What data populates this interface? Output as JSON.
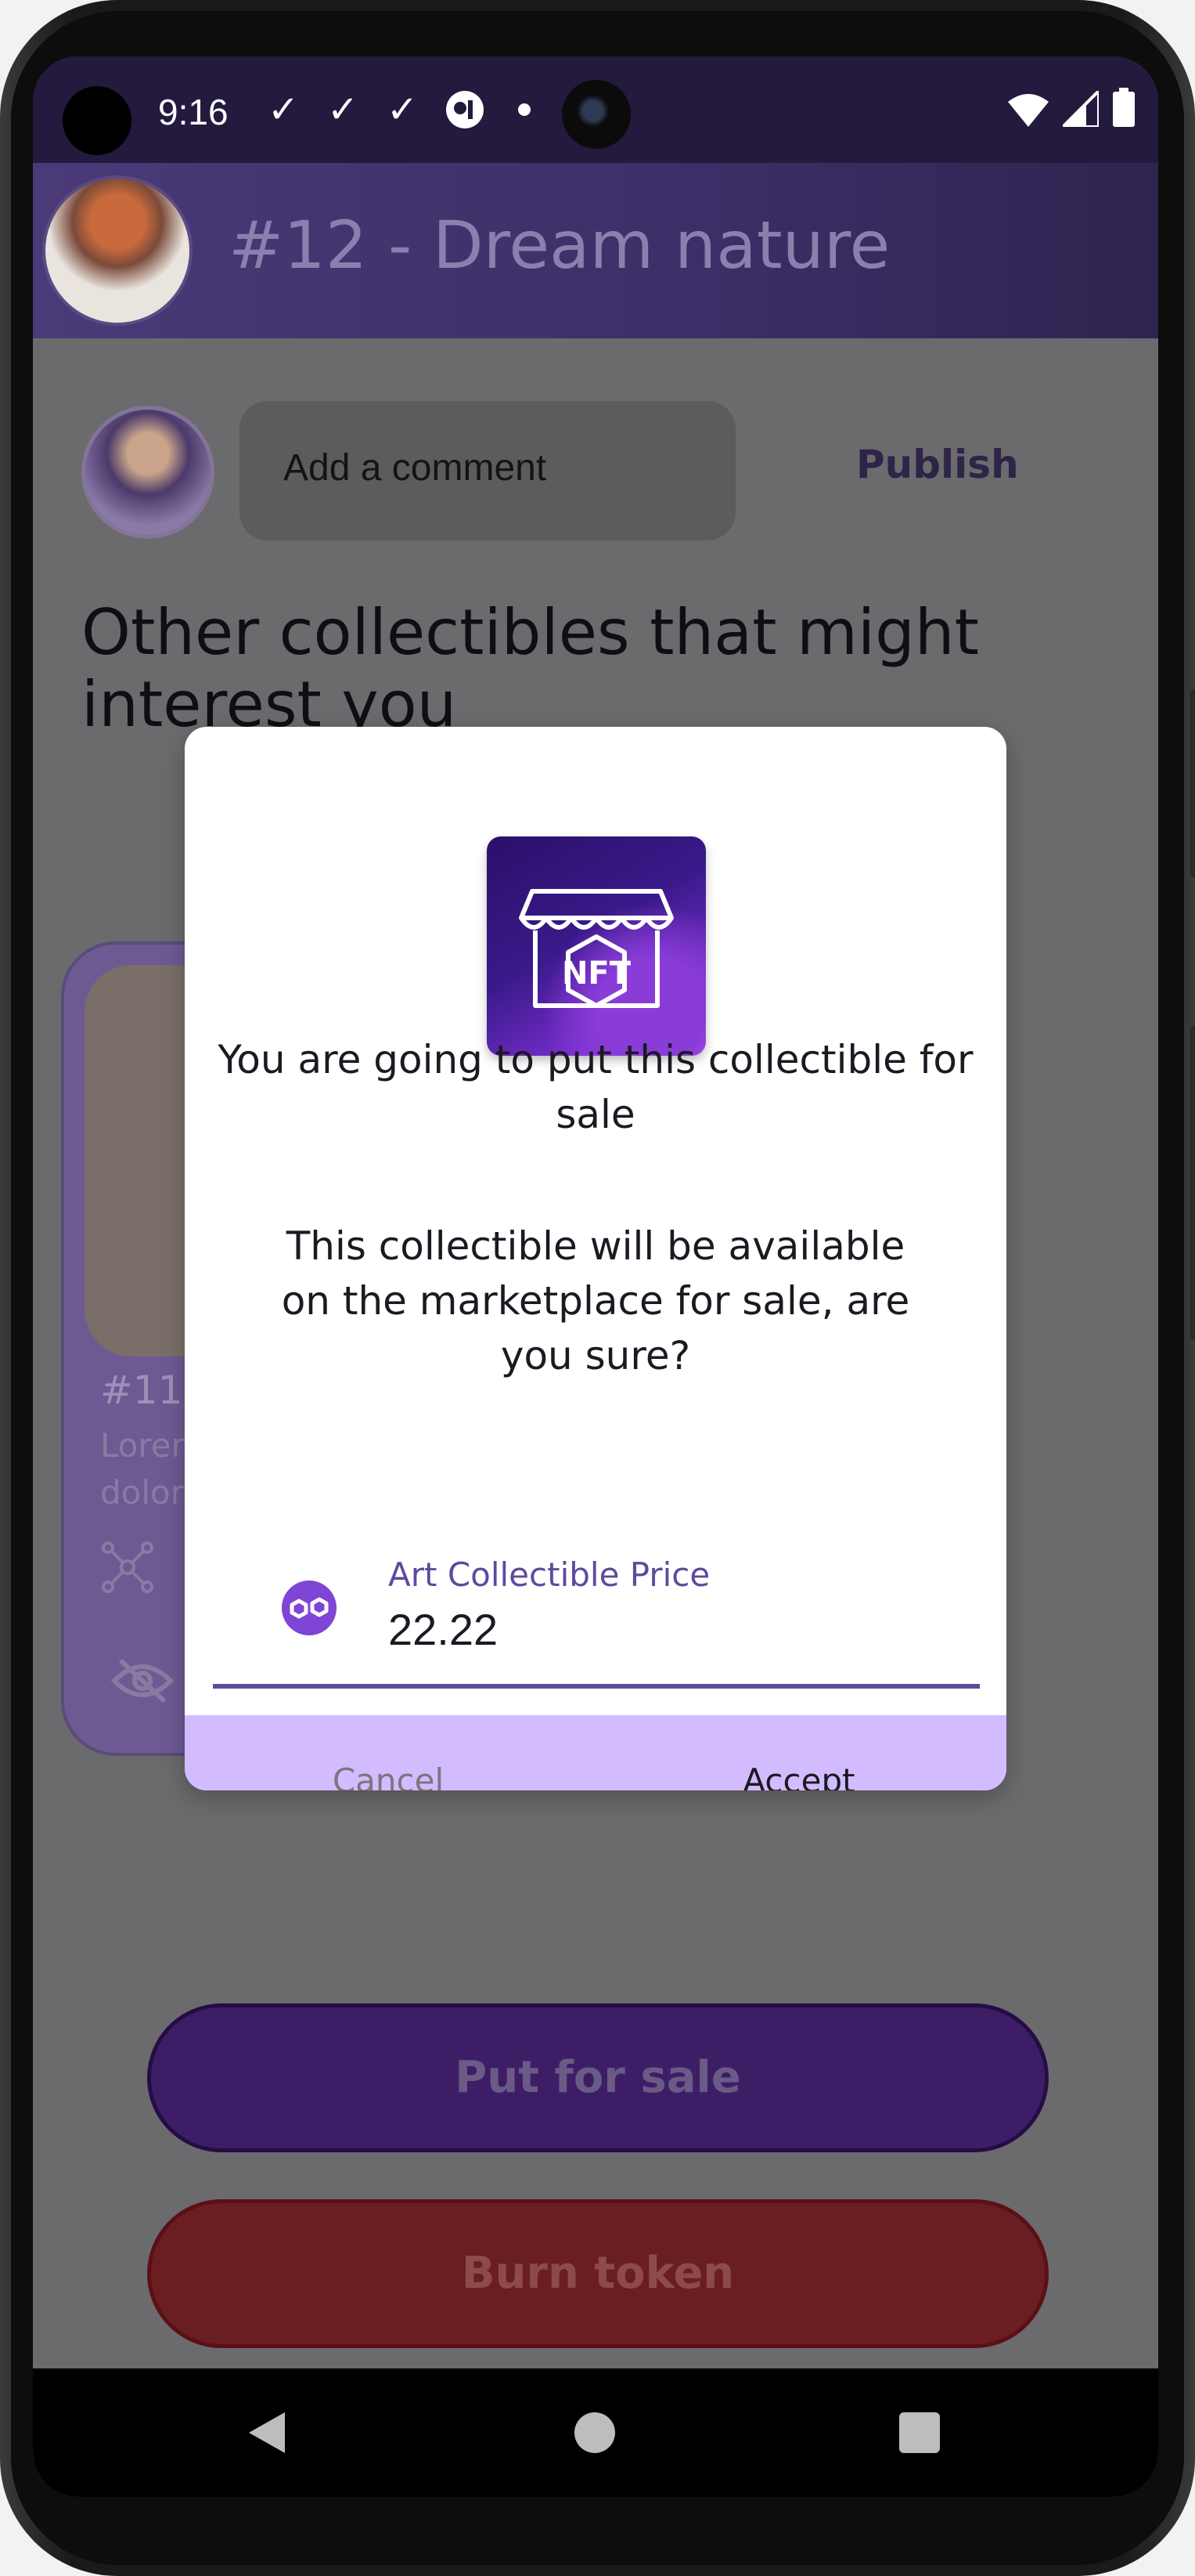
{
  "status_bar": {
    "time": "9:16",
    "notification_icons": [
      "check-icon",
      "check-icon",
      "check-icon",
      "vpn-key-icon"
    ],
    "system_icons": [
      "wifi-icon",
      "signal-icon",
      "battery-icon"
    ]
  },
  "app_bar": {
    "title": "#12 - Dream nature"
  },
  "comment": {
    "placeholder": "Add a comment",
    "publish_label": "Publish"
  },
  "section": {
    "title": "Other collectibles that might interest you"
  },
  "card": {
    "title": "#11 -",
    "desc": "Lorem ipsum dolor sit amet"
  },
  "actions": {
    "put_for_sale": "Put for sale",
    "burn_token": "Burn token"
  },
  "dialog": {
    "title": "You are going to put this collectible for sale",
    "body": "This collectible will be available on the marketplace for sale, are you sure?",
    "price_label": "Art Collectible Price",
    "price_value": "22.22",
    "cancel_label": "Cancel",
    "accept_label": "Accept",
    "accent_color": "#5e4a9e",
    "actions_bg": "#d2bcff"
  }
}
